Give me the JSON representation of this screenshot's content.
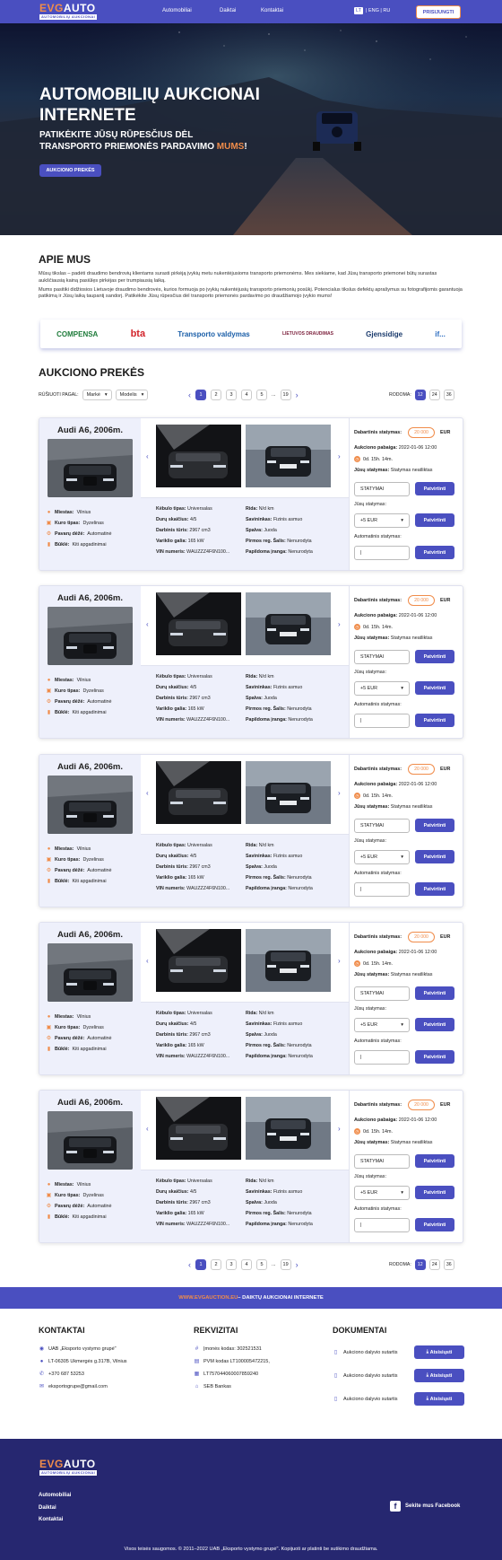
{
  "header": {
    "logo_main": "EVG",
    "logo_main2": "AUTO",
    "logo_sub": "AUTOMOBILIŲ AUKCIONAI",
    "nav": [
      "Automobiliai",
      "Daiktai",
      "Kontaktai"
    ],
    "lang_active": "LT",
    "lang_rest": "| ENG | RU",
    "login": "PRISIJUNGTI"
  },
  "hero": {
    "title": "AUTOMOBILIŲ AUKCIONAI INTERNETE",
    "subtitle": "PATIKĖKITE JŪSŲ RŪPESČIUS DĖL TRANSPORTO PRIEMONĖS PARDAVIMO",
    "subtitle_accent": "MUMS",
    "subtitle_end": "!",
    "cta": "AUKCIONO PREKĖS"
  },
  "about": {
    "title": "APIE MUS",
    "p1": "Mūsų tikslas – padėti draudimo bendrovių klientams surasti pirkėją įvykių metu nukentėjusioms transporto priemonėms. Mes siekiame, kad Jūsų transporto priemonei būtų surastas aukščiausią kainą pasiūlęs pirkėjas per trumpiausią laiką.",
    "p2": "Mums pasitiki didžiosios Lietuvoje draudimo bendrovės, kurios formuoja po įvykių nukentėjusių transporto priemonių posūkį. Potencialus tikslus defektų aprašymus su fotografijomis garantuoja patikimą ir Jūsų laiką taupantį sandorį. Patikėkite Jūsų rūpesčius dėl transporto priemonės pardavimo po draudžiamojo įvykio mums!",
    "partners": [
      "COMPENSA",
      "bta",
      "Transporto valdymas",
      "LIETUVOS DRAUDIMAS",
      "Gjensidige",
      "if..."
    ]
  },
  "auctions": {
    "title": "AUKCIONO PREKĖS",
    "sort_label": "RŪŠIUOTI PAGAL:",
    "sort1": "Markė",
    "sort2": "Modelis",
    "pages": [
      "1",
      "2",
      "3",
      "4",
      "5",
      "...",
      "19"
    ],
    "show_label": "RODOMA:",
    "show_opts": [
      "12",
      "24",
      "36"
    ]
  },
  "item": {
    "title": "Audi A6, 2006m.",
    "miestas_l": "Miestas:",
    "miestas": "Vilnius",
    "kuras_l": "Kuro tipas:",
    "kuras": "Dyzelinas",
    "pavaru_l": "Pavarų dėžė:",
    "pavaru": "Automatinė",
    "bukle_l": "Būklė:",
    "bukle": "Kiti apgadinimai",
    "kebulo_l": "Kėbulo tipas:",
    "kebulo": "Universalas",
    "duru_l": "Durų skaičius:",
    "duru": "4/5",
    "turis_l": "Darbinis tūris:",
    "turis": "2967 cm3",
    "galia_l": "Variklio galia:",
    "galia": "165 kW",
    "vin_l": "VIN numeris:",
    "vin": "WAUZZZ4F6N100...",
    "rida_l": "Rida:",
    "rida": "N/d km",
    "sav_l": "Savininkas:",
    "sav": "Fizinis asmuo",
    "spalva_l": "Spalva:",
    "spalva": "Juoda",
    "reg_l": "Pirmos reg. Šalis:",
    "reg": "Nenurodyta",
    "iranga_l": "Papildoma įranga:",
    "iranga": "Nenurodyta",
    "current_l": "Dabartinis statymas:",
    "current": "20 000",
    "currency": "EUR",
    "end_l": "Aukciono pabaiga:",
    "end": "2022-01-06 12:00",
    "left": "0d. 15h. 14m.",
    "yours_l": "Jūsų statymas:",
    "yours": "Statymas neatliktas",
    "bid_input": "STATYMAI",
    "bid_btn": "Patvirtinti",
    "raise_l": "Jūsų statymas:",
    "raise": "+5 EUR",
    "raise_btn": "Patvirtinti",
    "auto_l": "Automatinis statymas:",
    "auto_btn": "Patvirtinti"
  },
  "band": {
    "accent": "WWW.EVGAUCTION.EU",
    "text": " – DAIKTŲ AUKCIONAI INTERNETE"
  },
  "contacts": {
    "title": "KONTAKTAI",
    "rows": [
      "UAB „Eksporto vystymo grupė\"",
      "LT-06305 Ukmergės g.317B, Vilnius",
      "+370 687 53253",
      "eksportogrupe@gmail.com"
    ]
  },
  "requisites": {
    "title": "REKVIZITAI",
    "rows": [
      "Įmonės kodas: 302521531",
      "PVM kodas LT100005472215,",
      "LT757044060007859240",
      "SEB Bankas"
    ]
  },
  "documents": {
    "title": "DOKUMENTAI",
    "rows": [
      "Aukciono dalyvio sutartis",
      "Aukciono dalyvio sutartis",
      "Aukciono dalyvio sutartis"
    ],
    "download": "Atsisiųsti"
  },
  "footer": {
    "links": [
      "Automobiliai",
      "Daiktai",
      "Kontaktai"
    ],
    "facebook": "Sekite mus Facebook",
    "copyright": "Visos teisės saugomos. © 2011–2022 UAB „Eksporto vystymo grupė\". Kopijuoti ar platinti be sutikimo draudžiama."
  }
}
